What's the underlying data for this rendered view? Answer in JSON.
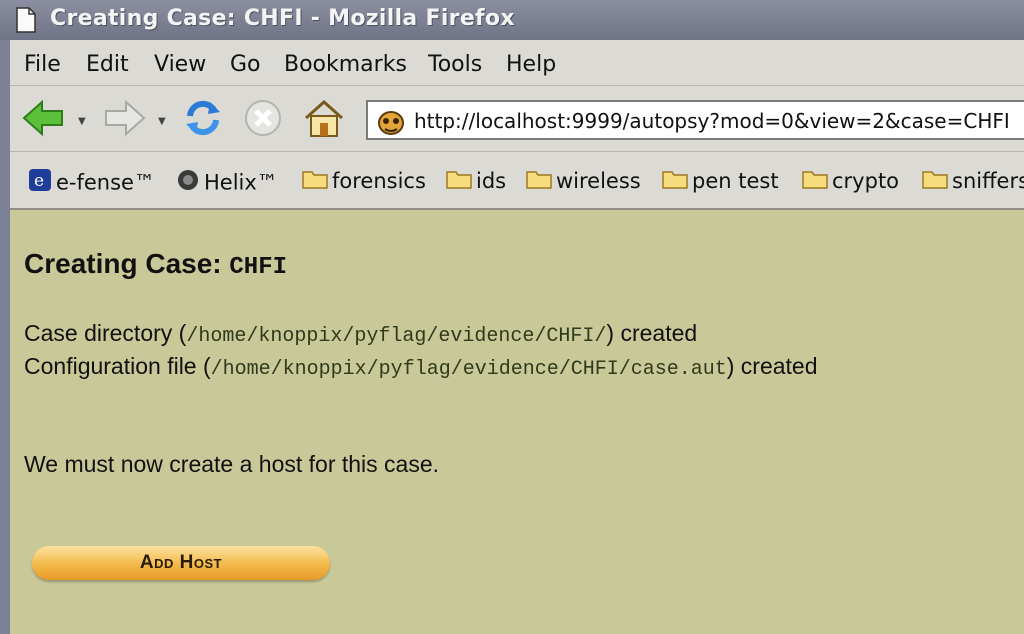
{
  "window": {
    "title": "Creating Case: CHFI - Mozilla Firefox"
  },
  "menubar": {
    "items": [
      {
        "label": "File"
      },
      {
        "label": "Edit"
      },
      {
        "label": "View"
      },
      {
        "label": "Go"
      },
      {
        "label": "Bookmarks"
      },
      {
        "label": "Tools"
      },
      {
        "label": "Help"
      }
    ]
  },
  "navbar": {
    "url": "http://localhost:9999/autopsy?mod=0&view=2&case=CHFI"
  },
  "bookmarks": {
    "items": [
      {
        "label": "e-fense™",
        "icon": "efense-icon"
      },
      {
        "label": "Helix™",
        "icon": "helix-icon"
      },
      {
        "label": "forensics",
        "icon": "folder-icon"
      },
      {
        "label": "ids",
        "icon": "folder-icon"
      },
      {
        "label": "wireless",
        "icon": "folder-icon"
      },
      {
        "label": "pen test",
        "icon": "folder-icon"
      },
      {
        "label": "crypto",
        "icon": "folder-icon"
      },
      {
        "label": "sniffers",
        "icon": "folder-icon"
      }
    ]
  },
  "content": {
    "heading_prefix": "Creating Case: ",
    "case_name": "CHFI",
    "case_dir_prefix": "Case directory (",
    "case_dir_path": "/home/knoppix/pyflag/evidence/CHFI/",
    "case_dir_suffix": ") created",
    "config_prefix": "Configuration file (",
    "config_path": "/home/knoppix/pyflag/evidence/CHFI/case.aut",
    "config_suffix": ") created",
    "message": "We must now create a host for this case.",
    "add_host_label": "Add Host"
  },
  "colors": {
    "page_background": "#c9c898",
    "chrome_background": "#dcdad5",
    "titlebar": "#7c8094",
    "button_orange": "#f3b94a"
  }
}
